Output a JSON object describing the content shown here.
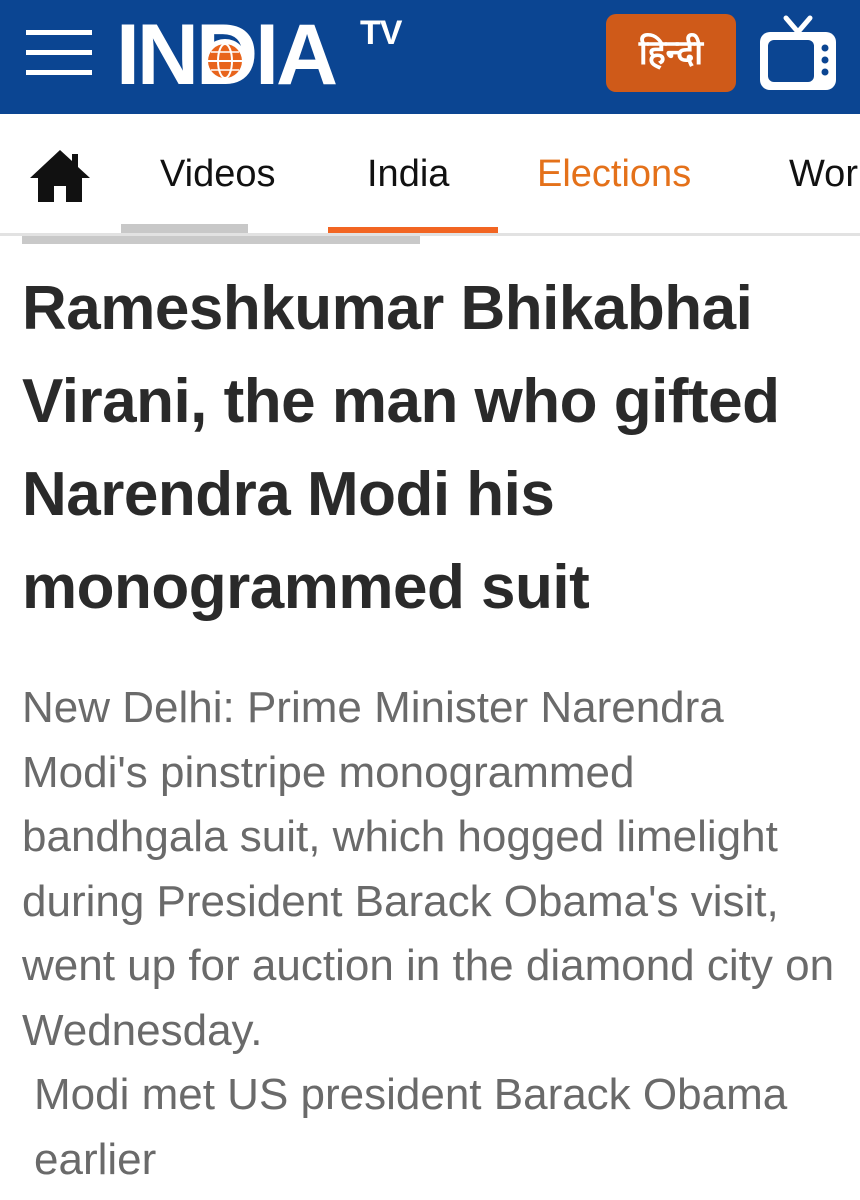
{
  "header": {
    "brand_main": "INDIA",
    "brand_sup": "TV",
    "language_button": "हिन्दी",
    "icons": {
      "menu": "hamburger-menu-icon",
      "live_tv": "television-icon"
    },
    "colors": {
      "header_bg": "#0b4592",
      "language_bg": "#cf5a19",
      "globe": "#e8641c"
    }
  },
  "nav": {
    "home_icon": "home-icon",
    "items": [
      {
        "label": "Videos"
      },
      {
        "label": "India"
      },
      {
        "label": "Elections"
      },
      {
        "label": "Wor"
      }
    ],
    "colors": {
      "elections": "#e4711a",
      "underline": "#f26522"
    }
  },
  "article": {
    "headline": "Rameshkumar Bhikabhai Virani, the man who gifted Narendra Modi his monogrammed suit",
    "summary_paragraph_1": "New Delhi: Prime Minister Narendra Modi's pinstripe monogrammed bandhgala suit, which hogged limelight during President Barack Obama's visit, went up for auction in the diamond city on Wednesday.",
    "summary_paragraph_2": "Modi met US president Barack Obama earlier"
  }
}
